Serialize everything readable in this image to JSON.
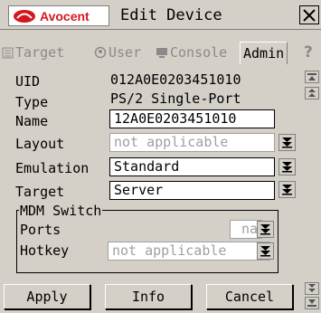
{
  "window": {
    "brand": "Avocent",
    "title": "Edit Device",
    "close_label": "X"
  },
  "tabs": [
    {
      "label": "Target",
      "icon": "target-icon",
      "active": false
    },
    {
      "label": "User",
      "icon": "user-icon",
      "active": false
    },
    {
      "label": "Console",
      "icon": "console-icon",
      "active": false
    },
    {
      "label": "Admin",
      "icon": "",
      "active": true
    }
  ],
  "help_label": "?",
  "fields": {
    "uid": {
      "label": "UID",
      "value": "012A0E0203451010"
    },
    "type": {
      "label": "Type",
      "value": "PS/2 Single-Port"
    },
    "name": {
      "label": "Name",
      "value": "12A0E0203451010"
    },
    "layout": {
      "label": "Layout",
      "value": "not applicable"
    },
    "emulation": {
      "label": "Emulation",
      "value": "Standard"
    },
    "target": {
      "label": "Target",
      "value": "Server"
    }
  },
  "mdm": {
    "title": "MDM Switch",
    "ports": {
      "label": "Ports",
      "value": "na"
    },
    "hotkey": {
      "label": "Hotkey",
      "value": "not applicable"
    }
  },
  "buttons": {
    "apply": "Apply",
    "info": "Info",
    "cancel": "Cancel"
  },
  "colors": {
    "background": "#d4d0c8",
    "brand_red": "#d4161f",
    "disabled_text": "#a0a0a0"
  }
}
